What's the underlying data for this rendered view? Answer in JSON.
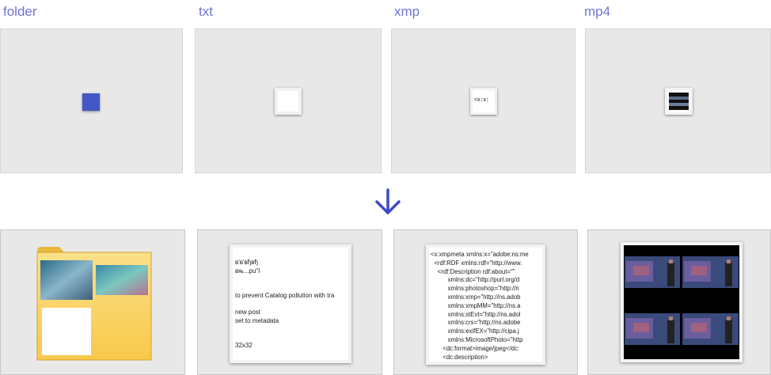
{
  "labels": {
    "folder": "folder",
    "txt": "txt",
    "xmp": "xmp",
    "mp4": "mp4"
  },
  "icons": {
    "transition": "arrow-down-icon"
  },
  "colors": {
    "label": "#6f74d8",
    "accent": "#4257c8",
    "panel_bg": "#e8e8e8",
    "folder_yellow": "#fbd56a"
  },
  "txt_preview": {
    "lines": [
      "в'в'вђвђ",
      "вњ...рu\"I",
      "",
      "",
      "to prevent Catalog pollution with tra",
      "",
      "new post",
      "set to metadata",
      "",
      "",
      "32x32"
    ]
  },
  "xmp_preview": {
    "lines": [
      "<x:xmpmeta xmlns:x=\"adobe:ns:me",
      "  <rdf:RDF xmlns:rdf=\"http://www.",
      "    <rdf:Description rdf:about=\"\"",
      "          xmlns:dc=\"http://purl.org/d",
      "          xmlns:photoshop=\"http://n",
      "          xmlns:xmp=\"http://ns.adob",
      "          xmlns:xmpMM=\"http://ns.a",
      "          xmlns:stEvt=\"http://ns.adol",
      "          xmlns:crs=\"http://ns.adobe",
      "          xmlns:exifEX=\"http://cipa.j",
      "          xmlns:MicrosoftPhoto=\"http",
      "       <dc:format>image/jpeg</dc:",
      "       <dc:description>"
    ]
  },
  "xmp_small_glyph": "<x:x:"
}
